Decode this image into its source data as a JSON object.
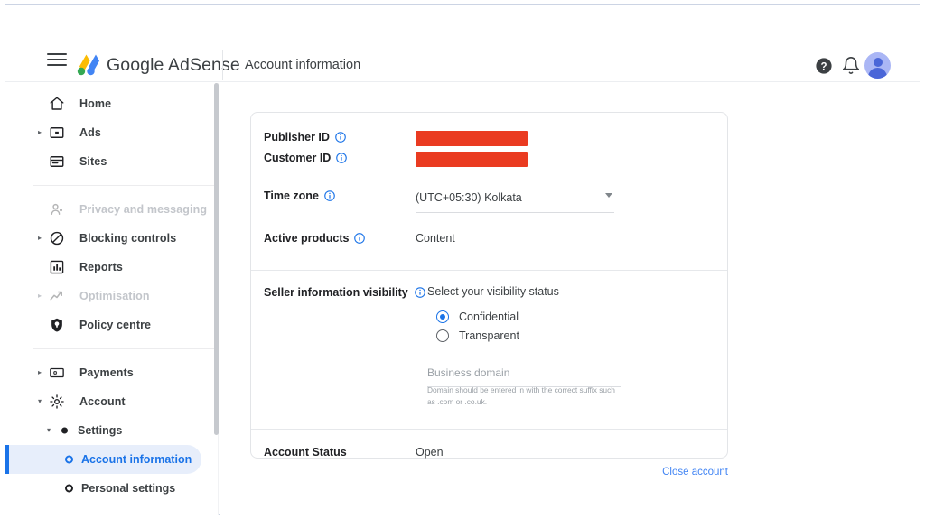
{
  "header": {
    "menu_icon": "hamburger-icon",
    "brand": "Google AdSense",
    "page_title": "Account information",
    "help_icon": "help-icon",
    "notifications_icon": "bell-icon",
    "avatar_icon": "avatar"
  },
  "sidebar": {
    "items": [
      {
        "label": "Home",
        "icon": "home-icon",
        "caret": "",
        "dim": false
      },
      {
        "label": "Ads",
        "icon": "ads-icon",
        "caret": "▸",
        "dim": false
      },
      {
        "label": "Sites",
        "icon": "sites-icon",
        "caret": "",
        "dim": false
      },
      {
        "label": "Privacy and messaging",
        "icon": "person-privacy-icon",
        "caret": "",
        "dim": true
      },
      {
        "label": "Blocking controls",
        "icon": "block-icon",
        "caret": "▸",
        "dim": false
      },
      {
        "label": "Reports",
        "icon": "reports-icon",
        "caret": "",
        "dim": false
      },
      {
        "label": "Optimisation",
        "icon": "trending-up-icon",
        "caret": "▸",
        "dim": true
      },
      {
        "label": "Policy centre",
        "icon": "shield-icon",
        "caret": "",
        "dim": false
      },
      {
        "label": "Payments",
        "icon": "payments-icon",
        "caret": "▸",
        "dim": false
      },
      {
        "label": "Account",
        "icon": "gear-icon",
        "caret": "▾",
        "dim": false
      }
    ],
    "settings": {
      "label": "Settings",
      "caret": "▾"
    },
    "leaves": [
      {
        "label": "Account information",
        "active": true
      },
      {
        "label": "Personal settings",
        "active": false
      }
    ]
  },
  "card": {
    "publisher_id": {
      "label": "Publisher ID",
      "value_redacted": true
    },
    "customer_id": {
      "label": "Customer ID",
      "value_redacted": true
    },
    "time_zone": {
      "label": "Time zone",
      "value": "(UTC+05:30) Kolkata"
    },
    "active_products": {
      "label": "Active products",
      "value": "Content"
    },
    "seller_visibility": {
      "label": "Seller information visibility",
      "heading": "Select your visibility status",
      "options": [
        {
          "label": "Confidential",
          "selected": true
        },
        {
          "label": "Transparent",
          "selected": false
        }
      ],
      "business_domain_placeholder": "Business domain",
      "business_domain_value": "",
      "hint": "Domain should be entered in with the correct suffix such as .com or .co.uk."
    },
    "account_status": {
      "label": "Account Status",
      "value": "Open"
    }
  },
  "footer": {
    "close_account": "Close account"
  },
  "colors": {
    "accent_blue": "#1a73e8",
    "link_blue": "#4285f4",
    "redaction_red": "#ea3b21",
    "active_pill": "#e7eefb",
    "text_primary": "#202124",
    "text_secondary": "#3c4043",
    "text_muted": "#9aa0a6",
    "border": "#e3e5e8"
  }
}
